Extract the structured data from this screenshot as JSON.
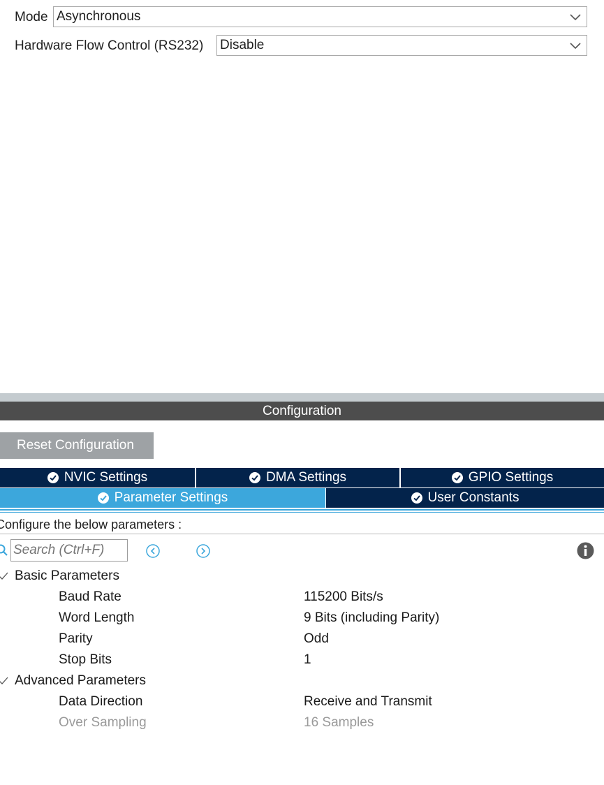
{
  "mode": {
    "label": "Mode",
    "value": "Asynchronous"
  },
  "flow_control": {
    "label": "Hardware Flow Control (RS232)",
    "value": "Disable"
  },
  "configuration": {
    "title": "Configuration",
    "reset_label": "Reset Configuration",
    "tabs": [
      {
        "label": "NVIC Settings",
        "active": false
      },
      {
        "label": "DMA Settings",
        "active": false
      },
      {
        "label": "GPIO Settings",
        "active": false
      },
      {
        "label": "Parameter Settings",
        "active": true
      },
      {
        "label": "User Constants",
        "active": false
      }
    ],
    "hint": "Configure the below parameters :",
    "search_placeholder": "Search (Ctrl+F)",
    "groups": [
      {
        "title": "Basic Parameters",
        "params": [
          {
            "name": "Baud Rate",
            "value": "115200 Bits/s"
          },
          {
            "name": "Word Length",
            "value": "9 Bits (including Parity)"
          },
          {
            "name": "Parity",
            "value": "Odd"
          },
          {
            "name": "Stop Bits",
            "value": "1"
          }
        ]
      },
      {
        "title": "Advanced Parameters",
        "params": [
          {
            "name": "Data Direction",
            "value": "Receive and Transmit"
          },
          {
            "name": "Over Sampling",
            "value": "16 Samples"
          }
        ]
      }
    ]
  },
  "colors": {
    "tab_active": "#3ca7dc",
    "tab_inactive": "#03234b",
    "header": "#4d4d4d",
    "reset_button": "#9ea2a5"
  }
}
